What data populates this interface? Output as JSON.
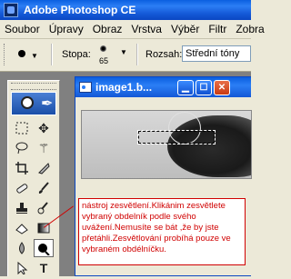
{
  "app": {
    "title": "Adobe Photoshop CE"
  },
  "menu": [
    "Soubor",
    "Úpravy",
    "Obraz",
    "Vrstva",
    "Výběr",
    "Filtr",
    "Zobra"
  ],
  "options": {
    "brush_label": "Stopa:",
    "brush_size": "65",
    "range_label": "Rozsah:",
    "range_value": "Střední tóny"
  },
  "image_window": {
    "title": "image1.b..."
  },
  "callout": {
    "text": "nástroj zesvětlení.Klikánim zesvětlete vybraný obdelník podle svého uvážení.Nemusíte se bát ,že by jste přetáhli.Zesvětlování probíhá pouze ve vybraném obdélníčku."
  },
  "colors": {
    "callout_red": "#d00000",
    "title_blue": "#0a5fe0"
  },
  "icons": {
    "toolbox": [
      "marquee-icon",
      "move-icon",
      "lasso-icon",
      "magic-wand-icon",
      "crop-icon",
      "slice-icon",
      "healing-icon",
      "brush-icon",
      "stamp-icon",
      "history-brush-icon",
      "eraser-icon",
      "gradient-icon",
      "blur-icon",
      "dodge-icon",
      "path-select-icon",
      "type-icon"
    ]
  }
}
